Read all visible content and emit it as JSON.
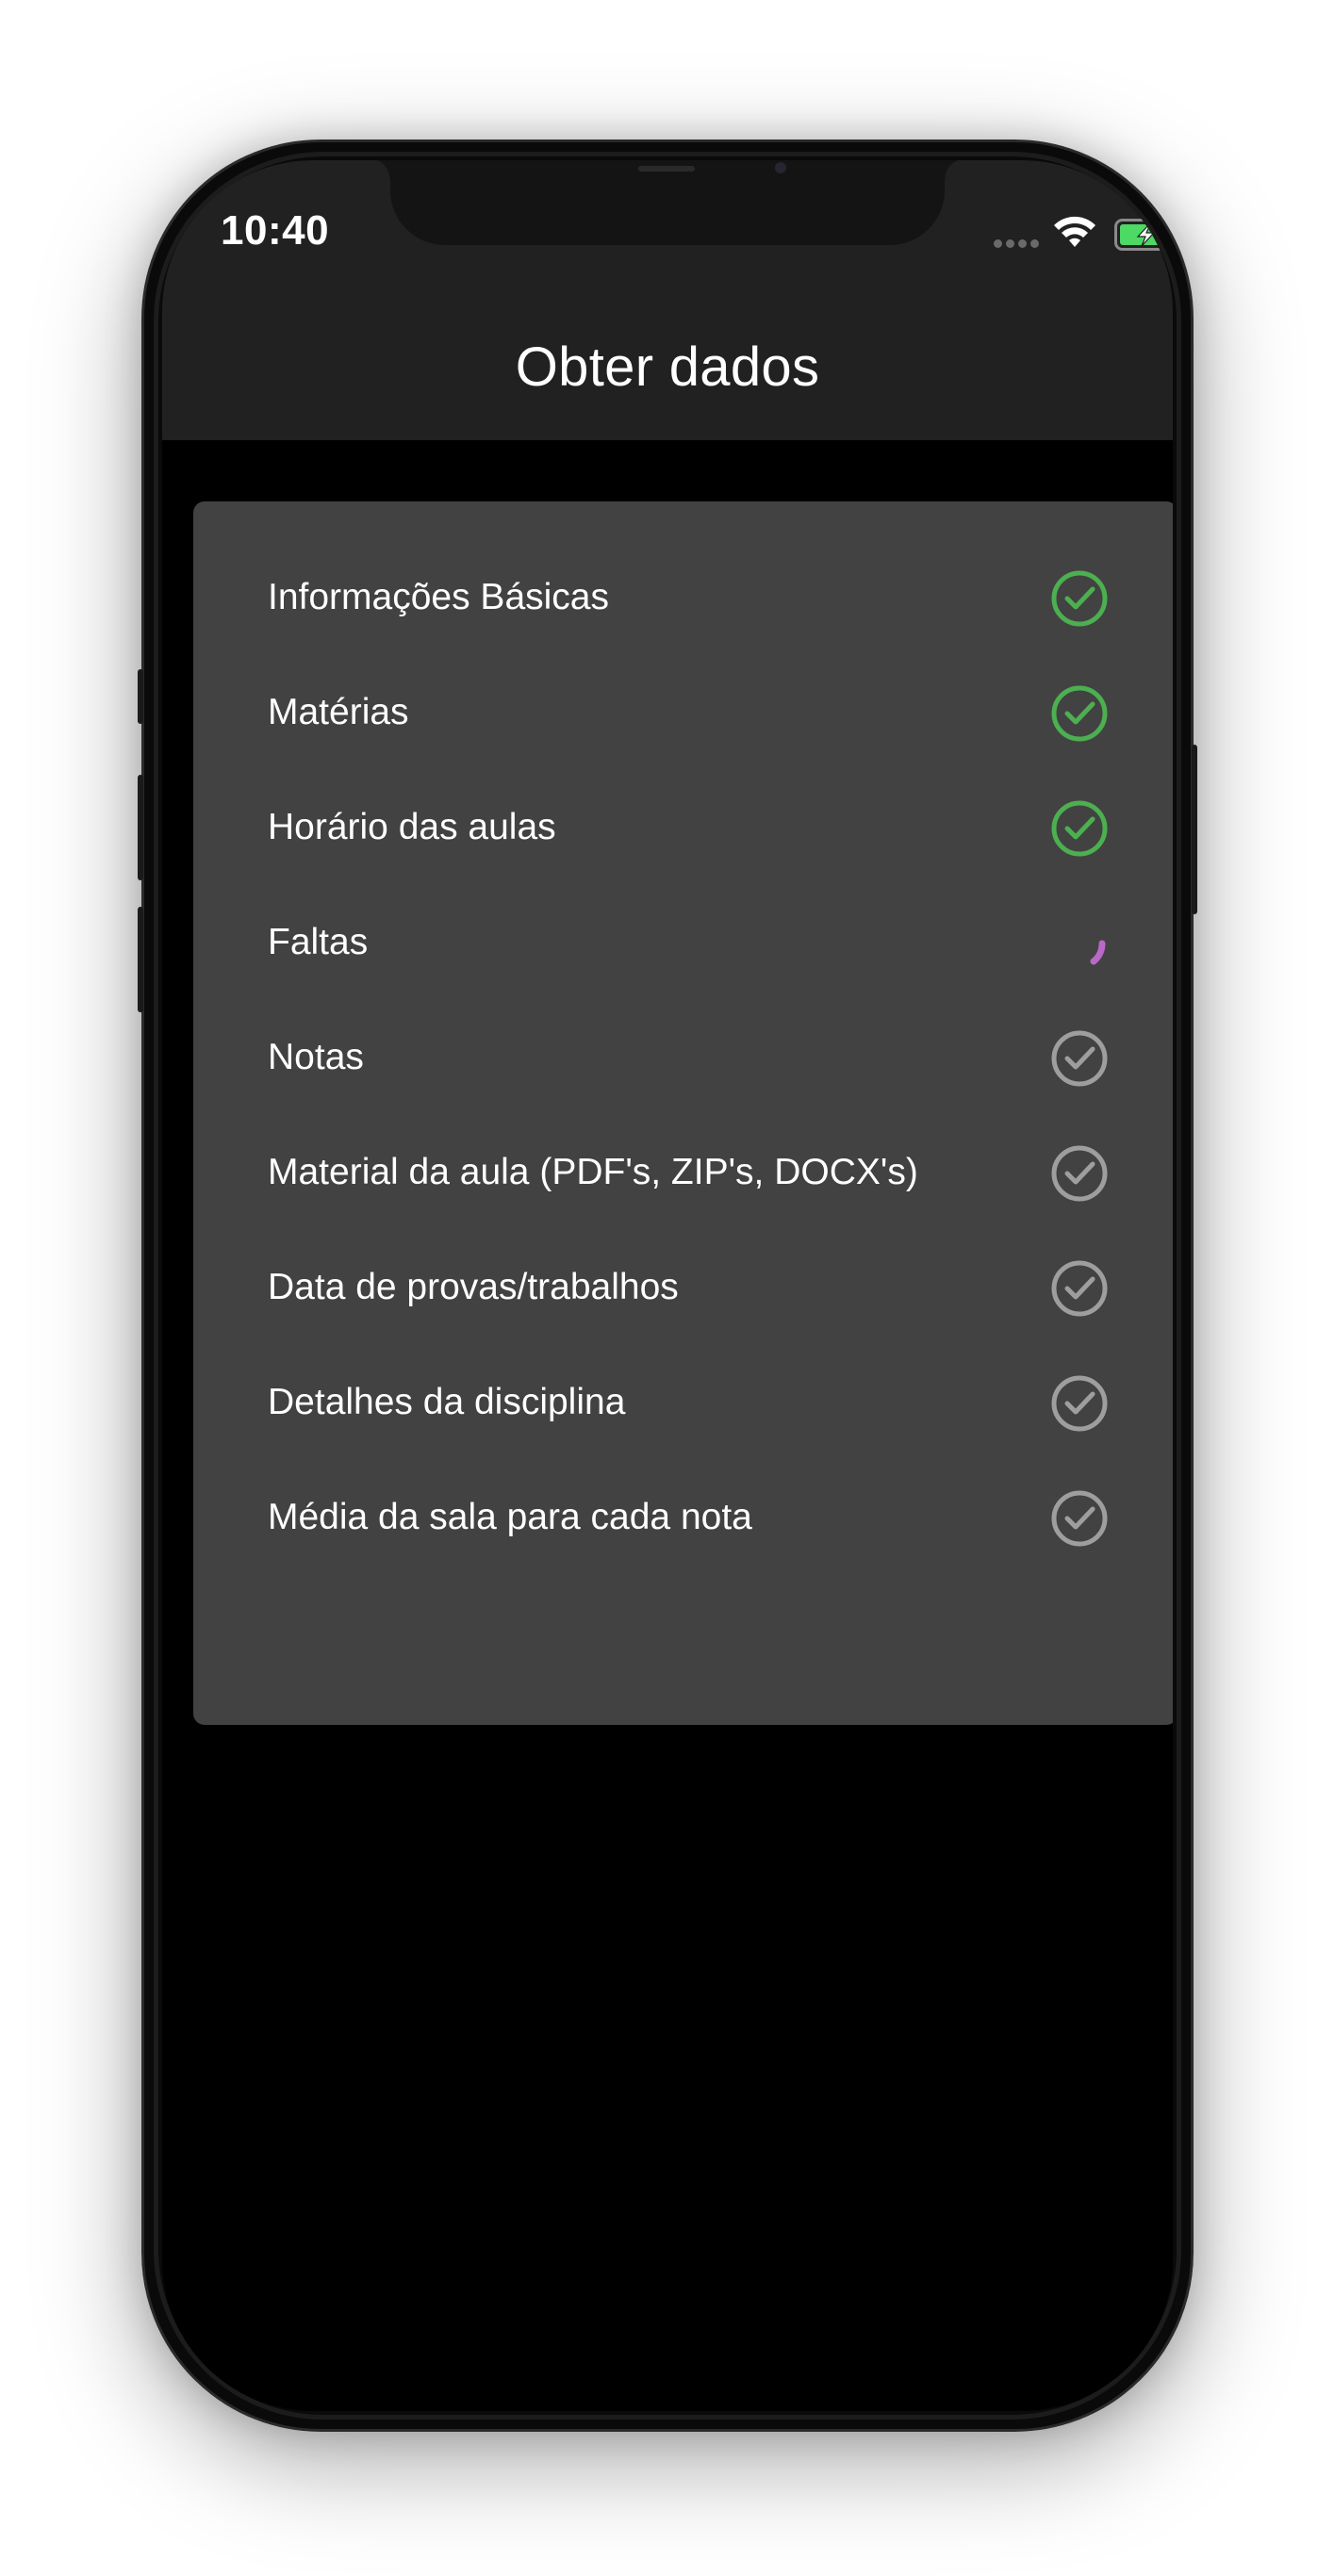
{
  "status_bar": {
    "time": "10:40",
    "battery_state": "charging",
    "battery_color": "#4cd964"
  },
  "navigation": {
    "title": "Obter dados"
  },
  "colors": {
    "complete": "#4caf50",
    "pending": "#9e9e9e",
    "loading": "#ba68c8",
    "card_background": "#424242",
    "nav_background": "#212121"
  },
  "sync_items": [
    {
      "label": "Informações Básicas",
      "status": "complete",
      "icon": "check-circle-icon"
    },
    {
      "label": "Matérias",
      "status": "complete",
      "icon": "check-circle-icon"
    },
    {
      "label": "Horário das aulas",
      "status": "complete",
      "icon": "check-circle-icon"
    },
    {
      "label": "Faltas",
      "status": "loading",
      "icon": "loading-spinner-icon"
    },
    {
      "label": "Notas",
      "status": "pending",
      "icon": "check-circle-icon"
    },
    {
      "label": "Material da aula (PDF's, ZIP's, DOCX's)",
      "status": "pending",
      "icon": "check-circle-icon"
    },
    {
      "label": "Data de provas/trabalhos",
      "status": "pending",
      "icon": "check-circle-icon"
    },
    {
      "label": "Detalhes da disciplina",
      "status": "pending",
      "icon": "check-circle-icon"
    },
    {
      "label": "Média da sala para cada nota",
      "status": "pending",
      "icon": "check-circle-icon"
    }
  ]
}
